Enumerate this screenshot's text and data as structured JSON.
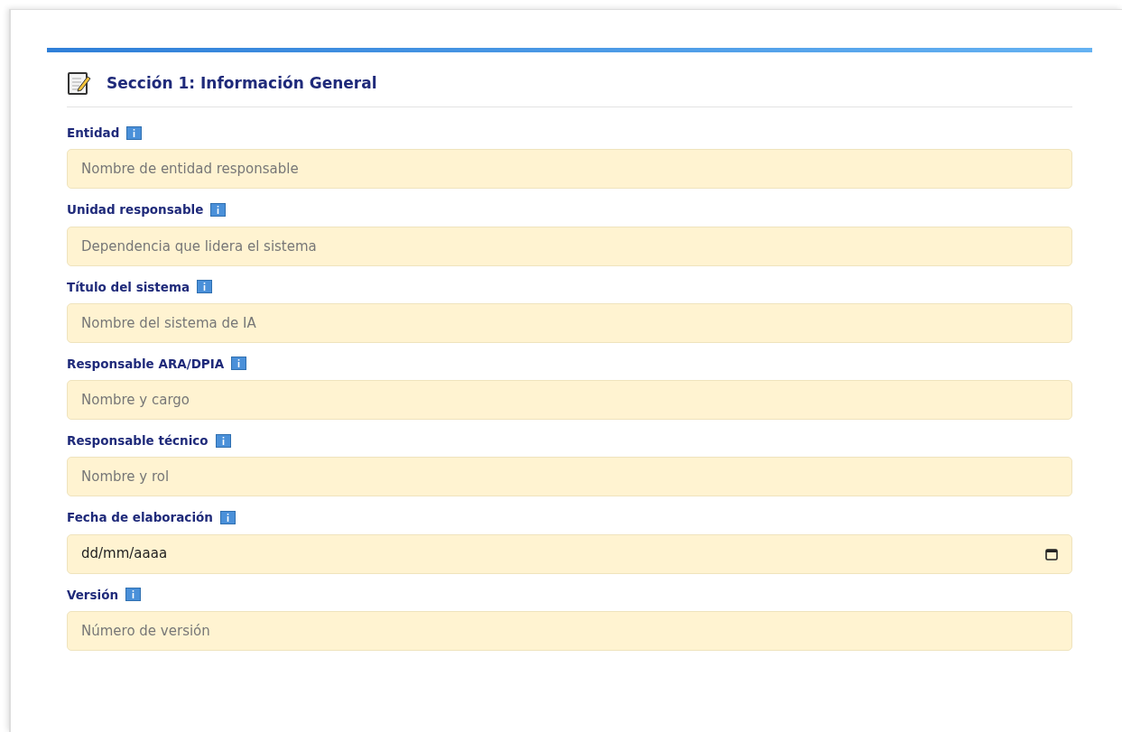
{
  "section": {
    "title": "Sección 1: Información General"
  },
  "fields": [
    {
      "kind": "text",
      "label": "Entidad",
      "placeholder": "Nombre de entidad responsable"
    },
    {
      "kind": "text",
      "label": "Unidad responsable",
      "placeholder": "Dependencia que lidera el sistema"
    },
    {
      "kind": "text",
      "label": "Título del sistema",
      "placeholder": "Nombre del sistema de IA"
    },
    {
      "kind": "text",
      "label": "Responsable ARA/DPIA",
      "placeholder": "Nombre y cargo"
    },
    {
      "kind": "text",
      "label": "Responsable técnico",
      "placeholder": "Nombre y rol"
    },
    {
      "kind": "date",
      "label": "Fecha de elaboración",
      "value": "dd/mm/aaaa"
    },
    {
      "kind": "text",
      "label": "Versión",
      "placeholder": "Número de versión"
    }
  ]
}
